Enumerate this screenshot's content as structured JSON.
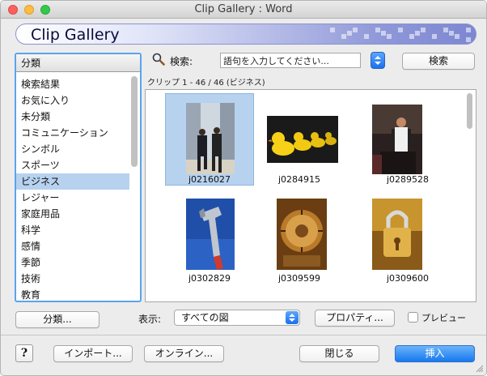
{
  "window": {
    "title": "Clip Gallery : Word"
  },
  "banner": {
    "title": "Clip Gallery"
  },
  "categories": {
    "header": "分類",
    "items": [
      {
        "label": "検索結果",
        "selected": false
      },
      {
        "label": "お気に入り",
        "selected": false
      },
      {
        "label": "未分類",
        "selected": false
      },
      {
        "label": "コミュニケーション",
        "selected": false
      },
      {
        "label": "シンボル",
        "selected": false
      },
      {
        "label": "スポーツ",
        "selected": false
      },
      {
        "label": "ビジネス",
        "selected": true
      },
      {
        "label": "レジャー",
        "selected": false
      },
      {
        "label": "家庭用品",
        "selected": false
      },
      {
        "label": "科学",
        "selected": false
      },
      {
        "label": "感情",
        "selected": false
      },
      {
        "label": "季節",
        "selected": false
      },
      {
        "label": "技術",
        "selected": false
      },
      {
        "label": "教育",
        "selected": false
      }
    ],
    "button": "分類..."
  },
  "search": {
    "label": "検索:",
    "value": "語句を入力してください...",
    "button": "検索"
  },
  "clip_count": "クリップ 1 - 46 / 46 (ビジネス)",
  "clips": [
    {
      "label": "j0216027",
      "selected": true,
      "icon": "businessmen-walking"
    },
    {
      "label": "j0284915",
      "selected": false,
      "icon": "rubber-ducks"
    },
    {
      "label": "j0289528",
      "selected": false,
      "icon": "presenter"
    },
    {
      "label": "j0302829",
      "selected": false,
      "icon": "hammer"
    },
    {
      "label": "j0309599",
      "selected": false,
      "icon": "safe-dial"
    },
    {
      "label": "j0309600",
      "selected": false,
      "icon": "padlock"
    }
  ],
  "show": {
    "label": "表示:",
    "selected": "すべての図"
  },
  "properties_button": "プロパティ...",
  "preview": {
    "label": "プレビュー",
    "checked": false
  },
  "footer": {
    "help": "?",
    "import": "インポート...",
    "online": "オンライン...",
    "close": "閉じる",
    "insert": "挿入"
  },
  "colors": {
    "accent": "#1779ee",
    "selection": "#b6d2ef",
    "focus": "#5aa4ec"
  }
}
